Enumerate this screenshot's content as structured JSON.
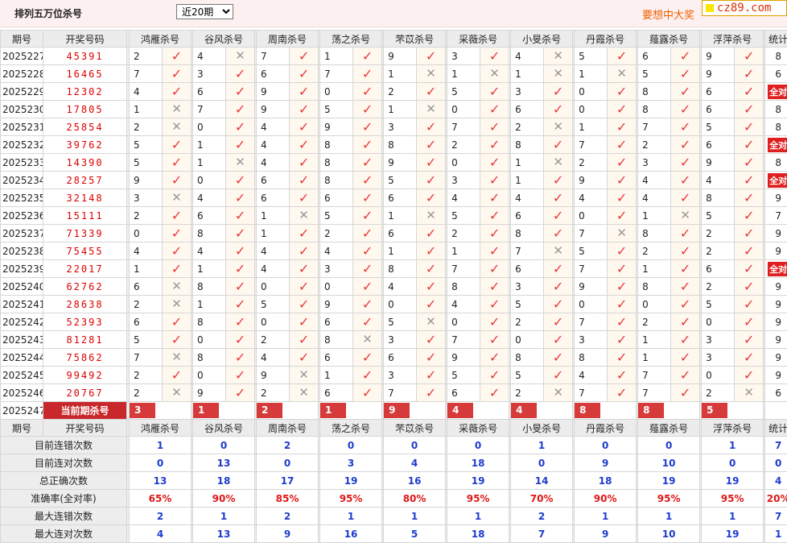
{
  "header": {
    "title": "排列五万位杀号",
    "period_select": "近20期",
    "ad_text": "要想中大奖",
    "logo": "cz89.com"
  },
  "columns": {
    "period": "期号",
    "draw": "开奖号码",
    "experts": [
      "鸿雁杀号",
      "谷风杀号",
      "周南杀号",
      "荡之杀号",
      "芣苡杀号",
      "采薇杀号",
      "小旻杀号",
      "丹霞杀号",
      "薤露杀号",
      "浮萍杀号"
    ],
    "count": "统计"
  },
  "all_correct_label": "全对",
  "rows": [
    {
      "period": "2025227",
      "draw": "45391",
      "kills": [
        [
          2,
          1
        ],
        [
          4,
          0
        ],
        [
          7,
          1
        ],
        [
          1,
          1
        ],
        [
          9,
          1
        ],
        [
          3,
          1
        ],
        [
          4,
          0
        ],
        [
          5,
          1
        ],
        [
          6,
          1
        ],
        [
          9,
          1
        ]
      ],
      "count": "8"
    },
    {
      "period": "2025228",
      "draw": "16465",
      "kills": [
        [
          7,
          1
        ],
        [
          3,
          1
        ],
        [
          6,
          1
        ],
        [
          7,
          1
        ],
        [
          1,
          0
        ],
        [
          1,
          0
        ],
        [
          1,
          0
        ],
        [
          1,
          0
        ],
        [
          5,
          1
        ],
        [
          9,
          1
        ]
      ],
      "count": "6"
    },
    {
      "period": "2025229",
      "draw": "12302",
      "kills": [
        [
          4,
          1
        ],
        [
          6,
          1
        ],
        [
          9,
          1
        ],
        [
          0,
          1
        ],
        [
          2,
          1
        ],
        [
          5,
          1
        ],
        [
          3,
          1
        ],
        [
          0,
          1
        ],
        [
          8,
          1
        ],
        [
          6,
          1
        ]
      ],
      "count": "全对"
    },
    {
      "period": "2025230",
      "draw": "17805",
      "kills": [
        [
          1,
          0
        ],
        [
          7,
          1
        ],
        [
          9,
          1
        ],
        [
          5,
          1
        ],
        [
          1,
          0
        ],
        [
          0,
          1
        ],
        [
          6,
          1
        ],
        [
          0,
          1
        ],
        [
          8,
          1
        ],
        [
          6,
          1
        ]
      ],
      "count": "8"
    },
    {
      "period": "2025231",
      "draw": "25854",
      "kills": [
        [
          2,
          0
        ],
        [
          0,
          1
        ],
        [
          4,
          1
        ],
        [
          9,
          1
        ],
        [
          3,
          1
        ],
        [
          7,
          1
        ],
        [
          2,
          0
        ],
        [
          1,
          1
        ],
        [
          7,
          1
        ],
        [
          5,
          1
        ]
      ],
      "count": "8"
    },
    {
      "period": "2025232",
      "draw": "39762",
      "kills": [
        [
          5,
          1
        ],
        [
          1,
          1
        ],
        [
          4,
          1
        ],
        [
          8,
          1
        ],
        [
          8,
          1
        ],
        [
          2,
          1
        ],
        [
          8,
          1
        ],
        [
          7,
          1
        ],
        [
          2,
          1
        ],
        [
          6,
          1
        ]
      ],
      "count": "全对"
    },
    {
      "period": "2025233",
      "draw": "14390",
      "kills": [
        [
          5,
          1
        ],
        [
          1,
          0
        ],
        [
          4,
          1
        ],
        [
          8,
          1
        ],
        [
          9,
          1
        ],
        [
          0,
          1
        ],
        [
          1,
          0
        ],
        [
          2,
          1
        ],
        [
          3,
          1
        ],
        [
          9,
          1
        ]
      ],
      "count": "8"
    },
    {
      "period": "2025234",
      "draw": "28257",
      "kills": [
        [
          9,
          1
        ],
        [
          0,
          1
        ],
        [
          6,
          1
        ],
        [
          8,
          1
        ],
        [
          5,
          1
        ],
        [
          3,
          1
        ],
        [
          1,
          1
        ],
        [
          9,
          1
        ],
        [
          4,
          1
        ],
        [
          4,
          1
        ]
      ],
      "count": "全对"
    },
    {
      "period": "2025235",
      "draw": "32148",
      "kills": [
        [
          3,
          0
        ],
        [
          4,
          1
        ],
        [
          6,
          1
        ],
        [
          6,
          1
        ],
        [
          6,
          1
        ],
        [
          4,
          1
        ],
        [
          4,
          1
        ],
        [
          4,
          1
        ],
        [
          4,
          1
        ],
        [
          8,
          1
        ]
      ],
      "count": "9"
    },
    {
      "period": "2025236",
      "draw": "15111",
      "kills": [
        [
          2,
          1
        ],
        [
          6,
          1
        ],
        [
          1,
          0
        ],
        [
          5,
          1
        ],
        [
          1,
          0
        ],
        [
          5,
          1
        ],
        [
          6,
          1
        ],
        [
          0,
          1
        ],
        [
          1,
          0
        ],
        [
          5,
          1
        ]
      ],
      "count": "7"
    },
    {
      "period": "2025237",
      "draw": "71339",
      "kills": [
        [
          0,
          1
        ],
        [
          8,
          1
        ],
        [
          1,
          1
        ],
        [
          2,
          1
        ],
        [
          6,
          1
        ],
        [
          2,
          1
        ],
        [
          8,
          1
        ],
        [
          7,
          0
        ],
        [
          8,
          1
        ],
        [
          2,
          1
        ]
      ],
      "count": "9"
    },
    {
      "period": "2025238",
      "draw": "75455",
      "kills": [
        [
          4,
          1
        ],
        [
          4,
          1
        ],
        [
          4,
          1
        ],
        [
          4,
          1
        ],
        [
          1,
          1
        ],
        [
          1,
          1
        ],
        [
          7,
          0
        ],
        [
          5,
          1
        ],
        [
          2,
          1
        ],
        [
          2,
          1
        ]
      ],
      "count": "9"
    },
    {
      "period": "2025239",
      "draw": "22017",
      "kills": [
        [
          1,
          1
        ],
        [
          1,
          1
        ],
        [
          4,
          1
        ],
        [
          3,
          1
        ],
        [
          8,
          1
        ],
        [
          7,
          1
        ],
        [
          6,
          1
        ],
        [
          7,
          1
        ],
        [
          1,
          1
        ],
        [
          6,
          1
        ]
      ],
      "count": "全对"
    },
    {
      "period": "2025240",
      "draw": "62762",
      "kills": [
        [
          6,
          0
        ],
        [
          8,
          1
        ],
        [
          0,
          1
        ],
        [
          0,
          1
        ],
        [
          4,
          1
        ],
        [
          8,
          1
        ],
        [
          3,
          1
        ],
        [
          9,
          1
        ],
        [
          8,
          1
        ],
        [
          2,
          1
        ]
      ],
      "count": "9"
    },
    {
      "period": "2025241",
      "draw": "28638",
      "kills": [
        [
          2,
          0
        ],
        [
          1,
          1
        ],
        [
          5,
          1
        ],
        [
          9,
          1
        ],
        [
          0,
          1
        ],
        [
          4,
          1
        ],
        [
          5,
          1
        ],
        [
          0,
          1
        ],
        [
          0,
          1
        ],
        [
          5,
          1
        ]
      ],
      "count": "9"
    },
    {
      "period": "2025242",
      "draw": "52393",
      "kills": [
        [
          6,
          1
        ],
        [
          8,
          1
        ],
        [
          0,
          1
        ],
        [
          6,
          1
        ],
        [
          5,
          0
        ],
        [
          0,
          1
        ],
        [
          2,
          1
        ],
        [
          7,
          1
        ],
        [
          2,
          1
        ],
        [
          0,
          1
        ]
      ],
      "count": "9"
    },
    {
      "period": "2025243",
      "draw": "81281",
      "kills": [
        [
          5,
          1
        ],
        [
          0,
          1
        ],
        [
          2,
          1
        ],
        [
          8,
          0
        ],
        [
          3,
          1
        ],
        [
          7,
          1
        ],
        [
          0,
          1
        ],
        [
          3,
          1
        ],
        [
          1,
          1
        ],
        [
          3,
          1
        ]
      ],
      "count": "9"
    },
    {
      "period": "2025244",
      "draw": "75862",
      "kills": [
        [
          7,
          0
        ],
        [
          8,
          1
        ],
        [
          4,
          1
        ],
        [
          6,
          1
        ],
        [
          6,
          1
        ],
        [
          9,
          1
        ],
        [
          8,
          1
        ],
        [
          8,
          1
        ],
        [
          1,
          1
        ],
        [
          3,
          1
        ]
      ],
      "count": "9"
    },
    {
      "period": "2025245",
      "draw": "99492",
      "kills": [
        [
          2,
          1
        ],
        [
          0,
          1
        ],
        [
          9,
          0
        ],
        [
          1,
          1
        ],
        [
          3,
          1
        ],
        [
          5,
          1
        ],
        [
          5,
          1
        ],
        [
          4,
          1
        ],
        [
          7,
          1
        ],
        [
          0,
          1
        ]
      ],
      "count": "9"
    },
    {
      "period": "2025246",
      "draw": "20767",
      "kills": [
        [
          2,
          0
        ],
        [
          9,
          1
        ],
        [
          2,
          0
        ],
        [
          6,
          1
        ],
        [
          7,
          1
        ],
        [
          6,
          1
        ],
        [
          2,
          0
        ],
        [
          7,
          1
        ],
        [
          7,
          1
        ],
        [
          2,
          0
        ]
      ],
      "count": "6"
    }
  ],
  "current": {
    "period": "2025247",
    "label": "当前期杀号",
    "kills": [
      "3",
      "1",
      "2",
      "1",
      "9",
      "4",
      "4",
      "8",
      "8",
      "5"
    ]
  },
  "stats": [
    {
      "label": "目前连错次数",
      "values": [
        "1",
        "0",
        "2",
        "0",
        "0",
        "0",
        "1",
        "0",
        "0",
        "1",
        "7"
      ],
      "red": false
    },
    {
      "label": "目前连对次数",
      "values": [
        "0",
        "13",
        "0",
        "3",
        "4",
        "18",
        "0",
        "9",
        "10",
        "0",
        "0"
      ],
      "red": false
    },
    {
      "label": "总正确次数",
      "values": [
        "13",
        "18",
        "17",
        "19",
        "16",
        "19",
        "14",
        "18",
        "19",
        "19",
        "4"
      ],
      "red": false
    },
    {
      "label": "准确率(全对率)",
      "values": [
        "65%",
        "90%",
        "85%",
        "95%",
        "80%",
        "95%",
        "70%",
        "90%",
        "95%",
        "95%",
        "20%"
      ],
      "red": true
    },
    {
      "label": "最大连错次数",
      "values": [
        "2",
        "1",
        "2",
        "1",
        "1",
        "1",
        "2",
        "1",
        "1",
        "1",
        "7"
      ],
      "red": false
    },
    {
      "label": "最大连对次数",
      "values": [
        "4",
        "13",
        "9",
        "16",
        "5",
        "18",
        "7",
        "9",
        "10",
        "19",
        "1"
      ],
      "red": false
    }
  ]
}
